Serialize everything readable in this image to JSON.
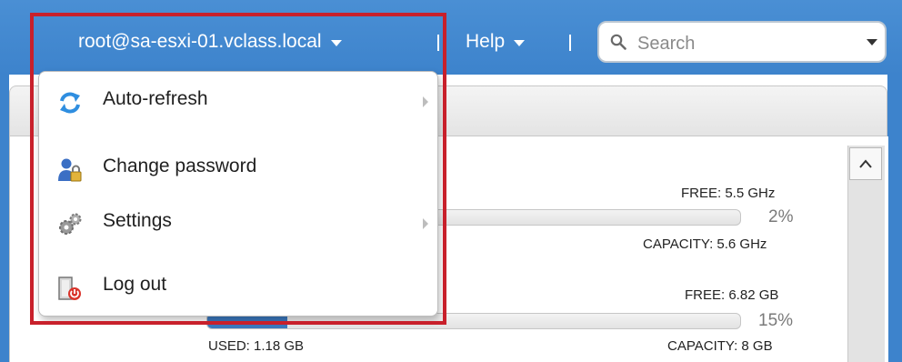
{
  "header": {
    "user_label": "root@sa-esxi-01.vclass.local",
    "help_label": "Help",
    "search_placeholder": "Search"
  },
  "user_menu": {
    "items": [
      {
        "label": "Auto-refresh",
        "icon": "refresh-icon",
        "has_submenu": true
      },
      {
        "label": "Change password",
        "icon": "user-lock-icon",
        "has_submenu": false
      },
      {
        "label": "Settings",
        "icon": "gears-icon",
        "has_submenu": true
      },
      {
        "label": "Log out",
        "icon": "logout-icon",
        "has_submenu": false
      }
    ]
  },
  "resources": {
    "cpu": {
      "free": "FREE: 5.5 GHz",
      "percent": "2%",
      "percent_value": 2,
      "capacity": "CAPACITY: 5.6 GHz"
    },
    "memory": {
      "free": "FREE: 6.82 GB",
      "percent": "15%",
      "percent_value": 15,
      "used": "USED: 1.18 GB",
      "capacity": "CAPACITY: 8 GB"
    }
  },
  "colors": {
    "header_blue": "#3d83cc",
    "highlight_red": "#c8202b",
    "bar_fill": "#3a79bf"
  }
}
